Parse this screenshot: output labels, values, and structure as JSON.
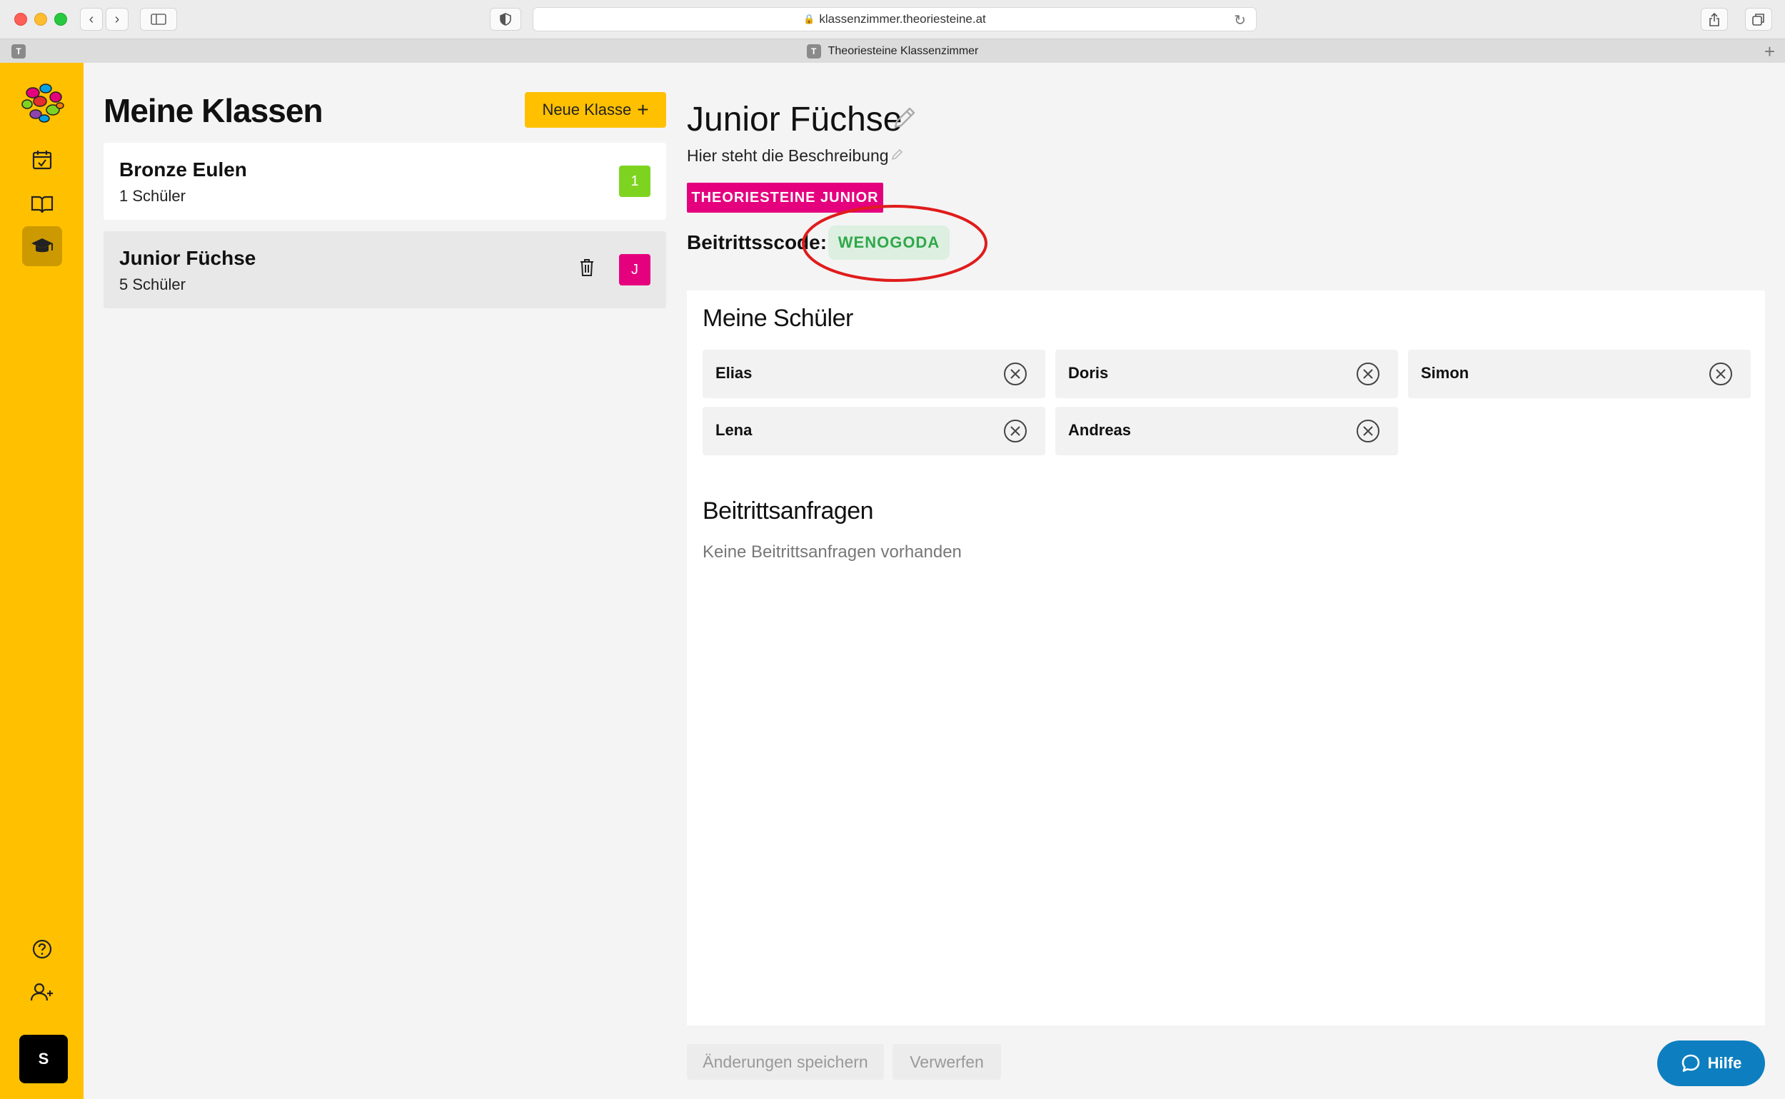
{
  "browser": {
    "url": "klassenzimmer.theoriesteine.at",
    "tab_title": "Theoriesteine Klassenzimmer",
    "favicon_letter": "T"
  },
  "sidebar": {
    "items": [
      {
        "icon": "calendar-check-icon"
      },
      {
        "icon": "book-open-icon"
      },
      {
        "icon": "graduation-cap-icon",
        "active": true
      }
    ],
    "bottom": [
      {
        "icon": "help-circle-icon"
      },
      {
        "icon": "add-user-icon"
      }
    ],
    "user_initial": "S",
    "accent": "#ffc000"
  },
  "classes": {
    "title": "Meine Klassen",
    "new_button_label": "Neue Klasse",
    "items": [
      {
        "name": "Bronze Eulen",
        "count": "1 Schüler",
        "badge": "1",
        "badge_color": "#7ed321"
      },
      {
        "name": "Junior Füchse",
        "count": "5 Schüler",
        "badge": "J",
        "badge_color": "#e5007e"
      }
    ]
  },
  "detail": {
    "name": "Junior Füchse",
    "description": "Hier steht die Beschreibung",
    "tag": "THEORIESTEINE JUNIOR",
    "code_label": "Beitrittsscode:",
    "code": "WENOGODA",
    "students_title": "Meine Schüler",
    "students": [
      "Elias",
      "Doris",
      "Simon",
      "Lena",
      "Andreas"
    ],
    "requests_title": "Beitrittsanfragen",
    "requests_empty": "Keine Beitrittsanfragen vorhanden"
  },
  "footer": {
    "save_label": "Änderungen speichern",
    "discard_label": "Verwerfen",
    "help_label": "Hilfe"
  }
}
